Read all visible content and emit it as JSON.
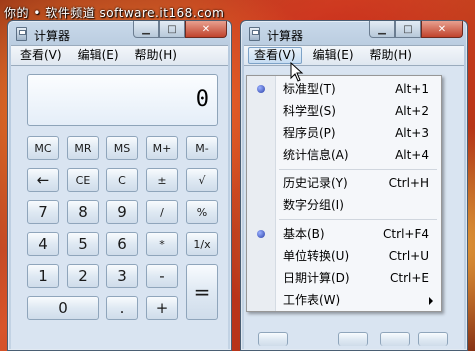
{
  "watermark": "你的 • 软件频道 software.it168.com",
  "window1": {
    "title": "计算器",
    "menu": [
      "查看(V)",
      "编辑(E)",
      "帮助(H)"
    ],
    "display_value": "0",
    "keys": [
      [
        "MC",
        "MR",
        "MS",
        "M+",
        "M-"
      ],
      [
        "←",
        "CE",
        "C",
        "±",
        "√"
      ],
      [
        "7",
        "8",
        "9",
        "/",
        "%"
      ],
      [
        "4",
        "5",
        "6",
        "*",
        "1/x"
      ],
      [
        "1",
        "2",
        "3",
        "-",
        "="
      ],
      [
        "0",
        ".",
        "+"
      ]
    ]
  },
  "window2": {
    "title": "计算器",
    "menu": [
      "查看(V)",
      "编辑(E)",
      "帮助(H)"
    ]
  },
  "dropdown": {
    "items": [
      {
        "label": "标准型(T)",
        "accel": "Alt+1",
        "selected": true
      },
      {
        "label": "科学型(S)",
        "accel": "Alt+2",
        "selected": false
      },
      {
        "label": "程序员(P)",
        "accel": "Alt+3",
        "selected": false
      },
      {
        "label": "统计信息(A)",
        "accel": "Alt+4",
        "selected": false
      },
      {
        "label": "历史记录(Y)",
        "accel": "Ctrl+H",
        "selected": false
      },
      {
        "label": "数字分组(I)",
        "accel": "",
        "selected": false
      },
      {
        "label": "基本(B)",
        "accel": "Ctrl+F4",
        "selected": true
      },
      {
        "label": "单位转换(U)",
        "accel": "Ctrl+U",
        "selected": false
      },
      {
        "label": "日期计算(D)",
        "accel": "Ctrl+E",
        "selected": false
      },
      {
        "label": "工作表(W)",
        "accel": "",
        "selected": false,
        "submenu": true
      }
    ]
  },
  "colors": {
    "menu_active": "#c5dcf2",
    "close_button": "#c0432c"
  }
}
